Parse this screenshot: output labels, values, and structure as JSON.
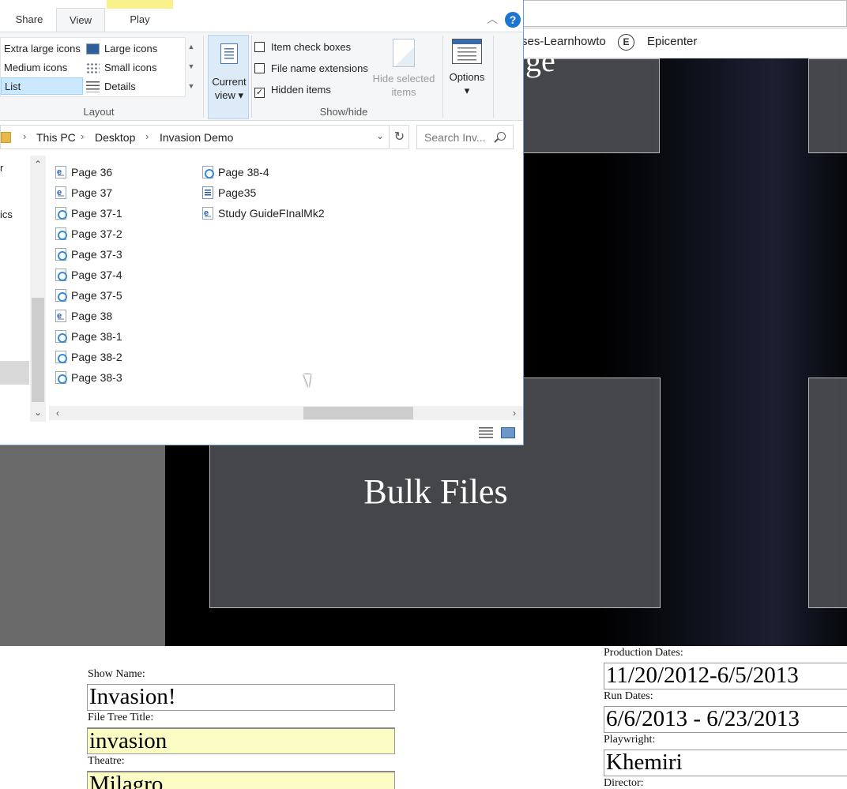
{
  "browser": {
    "bookmarks": [
      {
        "label": "ses-Learnhowto"
      },
      {
        "label": "Epicenter",
        "icon_letter": "E"
      }
    ]
  },
  "page": {
    "tiles": [
      {
        "title": "ge"
      },
      {
        "title": ""
      },
      {
        "title": "Bulk Files"
      },
      {
        "title": ""
      }
    ],
    "form": {
      "show_name": {
        "label": "Show Name:",
        "value": "Invasion!"
      },
      "file_tree_title": {
        "label": "File Tree Title:",
        "value": "invasion"
      },
      "theatre": {
        "label": "Theatre:",
        "value": "Milagro"
      },
      "production_dates": {
        "label": "Production Dates:",
        "value": "11/20/2012-6/5/2013"
      },
      "run_dates": {
        "label": "Run Dates:",
        "value": "6/6/2013 - 6/23/2013"
      },
      "playwright": {
        "label": "Playwright:",
        "value": "Khemiri"
      },
      "director": {
        "label": "Director:",
        "value": ""
      }
    }
  },
  "explorer": {
    "tabs": [
      "Share",
      "View",
      "Play"
    ],
    "active_tab": "View",
    "play_tab_color": "#f8f18c",
    "help_label": "?",
    "layout": {
      "items": [
        {
          "label": "Extra large icons",
          "icon": "extra-large-icons-icon"
        },
        {
          "label": "Large icons",
          "icon": "large-icons-icon"
        },
        {
          "label": "Medium icons",
          "icon": "medium-icons-icon"
        },
        {
          "label": "Small icons",
          "icon": "small-icons-icon"
        },
        {
          "label": "List",
          "icon": "list-icon",
          "selected": true
        },
        {
          "label": "Details",
          "icon": "details-icon"
        }
      ],
      "group_label": "Layout"
    },
    "current_view": {
      "line1": "Current",
      "line2": "view"
    },
    "show_hide": {
      "item_check_boxes": {
        "label": "Item check boxes",
        "checked": false
      },
      "file_name_extensions": {
        "label": "File name extensions",
        "checked": false
      },
      "hidden_items": {
        "label": "Hidden items",
        "checked": true
      },
      "hide_selected": {
        "line1": "Hide selected",
        "line2": "items"
      },
      "group_label": "Show/hide"
    },
    "options_label": "Options",
    "address": {
      "crumbs": [
        "This PC",
        "Desktop",
        "Invasion Demo"
      ],
      "search_placeholder": "Search Inv..."
    },
    "nav_pane": {
      "partial_1": "r",
      "partial_2": "ics"
    },
    "files_col1": [
      {
        "name": "Page 36",
        "icon": "pdf-file-icon"
      },
      {
        "name": "Page 37",
        "icon": "pdf-file-icon"
      },
      {
        "name": "Page 37-1",
        "icon": "swirl-file-icon"
      },
      {
        "name": "Page 37-2",
        "icon": "swirl-file-icon"
      },
      {
        "name": "Page 37-3",
        "icon": "swirl-file-icon"
      },
      {
        "name": "Page 37-4",
        "icon": "swirl-file-icon"
      },
      {
        "name": "Page 37-5",
        "icon": "swirl-file-icon"
      },
      {
        "name": "Page 38",
        "icon": "pdf-file-icon"
      },
      {
        "name": "Page 38-1",
        "icon": "swirl-file-icon"
      },
      {
        "name": "Page 38-2",
        "icon": "swirl-file-icon"
      },
      {
        "name": "Page 38-3",
        "icon": "swirl-file-icon"
      }
    ],
    "files_col2": [
      {
        "name": "Page 38-4",
        "icon": "swirl-file-icon"
      },
      {
        "name": "Page35",
        "icon": "word-doc-icon"
      },
      {
        "name": "Study GuideFInalMk2",
        "icon": "pdf-file-icon"
      }
    ]
  }
}
